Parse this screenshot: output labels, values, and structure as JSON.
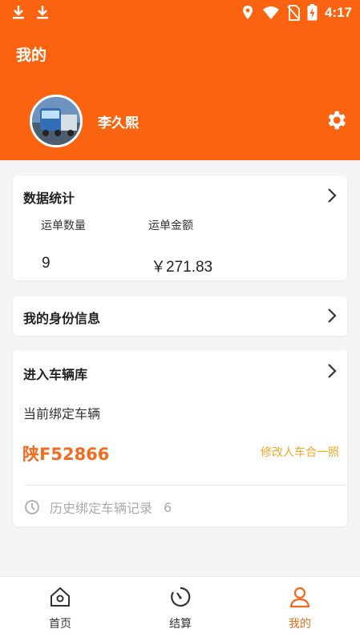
{
  "status_bar": {
    "time": "4:17"
  },
  "header": {
    "title": "我的",
    "user_name": "李久熙"
  },
  "stats_card": {
    "title": "数据统计",
    "waybill_count_label": "运单数量",
    "waybill_amount_label": "运单金额",
    "waybill_count": "9",
    "waybill_amount": "￥271.83"
  },
  "identity_card": {
    "title": "我的身份信息"
  },
  "vehicle_card": {
    "title": "进入车辆库",
    "current_label": "当前绑定车辆",
    "plate": "陕F52866",
    "modify_link": "修改人车合一照",
    "history_label": "历史绑定车辆记录",
    "history_count": "6"
  },
  "tabbar": {
    "tabs": [
      {
        "label": "首页",
        "icon": "home-icon"
      },
      {
        "label": "结算",
        "icon": "timer-icon"
      },
      {
        "label": "我的",
        "icon": "person-icon"
      }
    ],
    "active_index": 2
  },
  "colors": {
    "brand": "#fa6410",
    "plate": "#f36c21",
    "link": "#f5a623"
  }
}
